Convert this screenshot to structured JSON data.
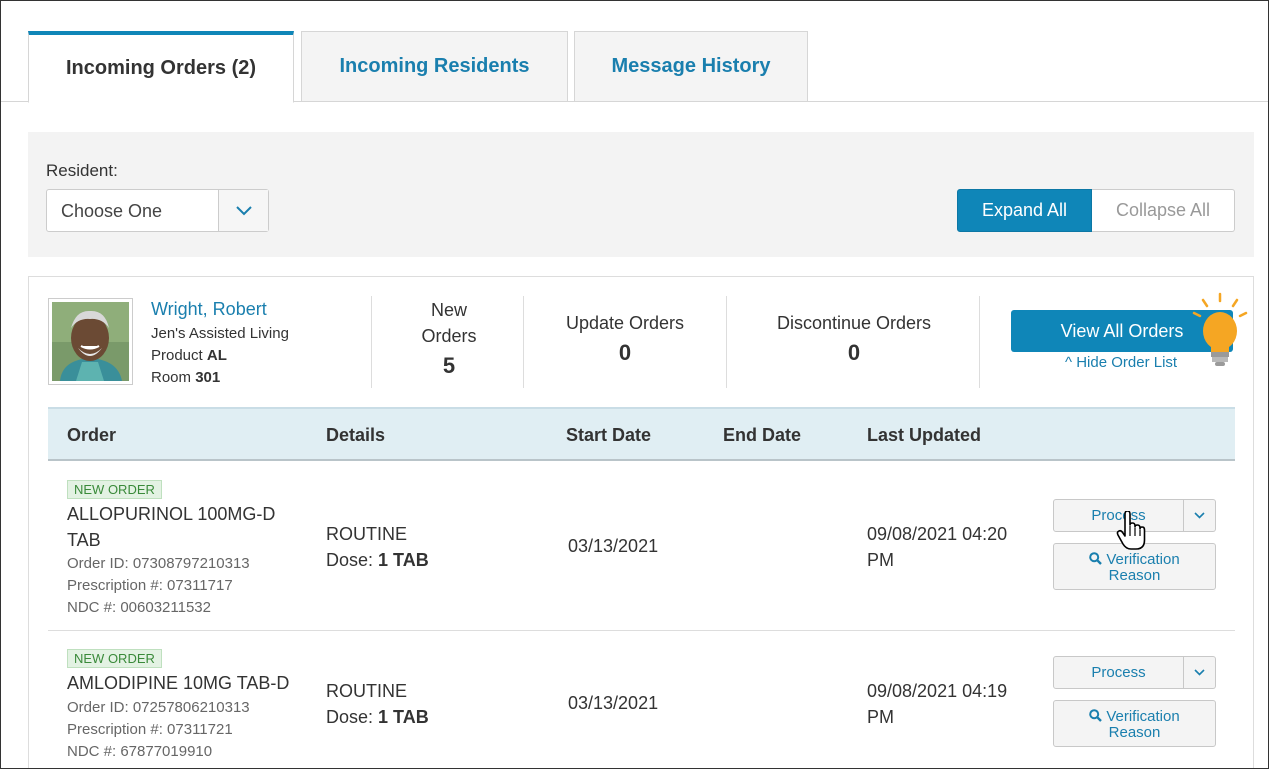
{
  "tabs": [
    {
      "label": "Incoming Orders (2)",
      "active": true
    },
    {
      "label": "Incoming Residents",
      "active": false
    },
    {
      "label": "Message History",
      "active": false
    }
  ],
  "filter": {
    "resident_label": "Resident:",
    "resident_value": "Choose One",
    "expand_all": "Expand All",
    "collapse_all": "Collapse All"
  },
  "resident": {
    "name": "Wright, Robert",
    "facility": "Jen's Assisted Living",
    "product_label": "Product",
    "product_value": "AL",
    "room_label": "Room",
    "room_value": "301",
    "stats": [
      {
        "label_line1": "New",
        "label_line2": "Orders",
        "value": "5"
      },
      {
        "label_line1": "Update Orders",
        "label_line2": "",
        "value": "0"
      },
      {
        "label_line1": "Discontinue Orders",
        "label_line2": "",
        "value": "0"
      }
    ],
    "view_all_label": "View All Orders",
    "hide_link": "^ Hide Order List"
  },
  "table": {
    "headers": [
      "Order",
      "Details",
      "Start Date",
      "End Date",
      "Last Updated"
    ],
    "rows": [
      {
        "badge": "NEW ORDER",
        "med_line1": "ALLOPURINOL 100MG-D",
        "med_line2": "TAB",
        "order_id": "Order ID: 07308797210313",
        "prescription": "Prescription #: 07311717",
        "ndc": "NDC #: 00603211532",
        "details_line1": "ROUTINE",
        "dose_label": "Dose:",
        "dose_value": "1 TAB",
        "start_date": "03/13/2021",
        "end_date": "",
        "updated_line1": "09/08/2021 04:20",
        "updated_line2": "PM",
        "process": "Process",
        "verify_line1": "Verification",
        "verify_line2": "Reason"
      },
      {
        "badge": "NEW ORDER",
        "med_line1": "AMLODIPINE 10MG TAB-D",
        "med_line2": "",
        "order_id": "Order ID: 07257806210313",
        "prescription": "Prescription #: 07311721",
        "ndc": "NDC #: 67877019910",
        "details_line1": "ROUTINE",
        "dose_label": "Dose:",
        "dose_value": "1 TAB",
        "start_date": "03/13/2021",
        "end_date": "",
        "updated_line1": "09/08/2021 04:19",
        "updated_line2": "PM",
        "process": "Process",
        "verify_line1": "Verification",
        "verify_line2": "Reason"
      }
    ]
  },
  "colors": {
    "accent": "#0f86b8",
    "link": "#1a7fae",
    "header_bg": "#e0eef3",
    "badge_green": "#3a8a3a",
    "bulb": "#f5a623"
  },
  "icons": [
    "chevron-down-icon",
    "search-icon",
    "lightbulb-icon",
    "hand-cursor-icon",
    "resident-photo"
  ]
}
